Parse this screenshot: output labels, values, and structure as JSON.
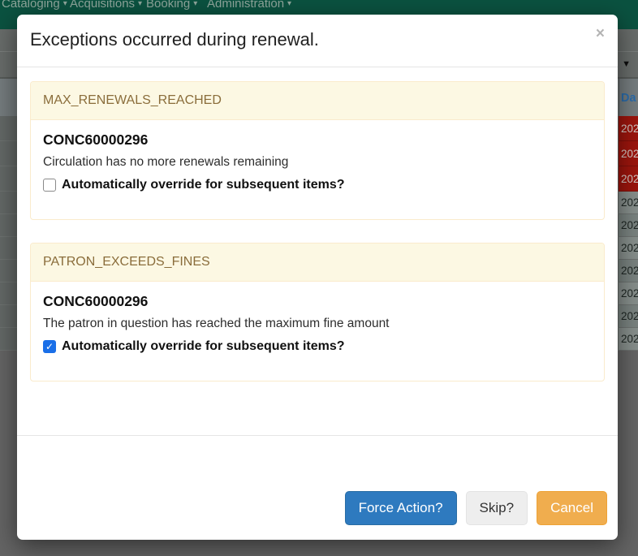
{
  "icons": {
    "caret_down": "▾",
    "grid_caret": "▼",
    "close": "×",
    "checkmark": "✓"
  },
  "colors": {
    "navbar_green": "#0b5240",
    "overdue_cell_red": "#9c150d",
    "panel_heading_bg": "#fcf8e3",
    "panel_heading_text": "#8a6d3b",
    "primary_button": "#2e7abf",
    "warning_button": "#f0ad4e",
    "checked_checkbox": "#1a6fe8"
  },
  "navbar": {
    "items": [
      {
        "label": "Cataloging"
      },
      {
        "label": "Acquisitions"
      },
      {
        "label": "Booking"
      },
      {
        "label": "Administration"
      }
    ]
  },
  "background_grid": {
    "column_header_fragment": "Da",
    "rows": [
      {
        "text": "202",
        "overdue": true
      },
      {
        "text": "202",
        "overdue": true
      },
      {
        "text": "202",
        "overdue": true
      },
      {
        "text": "202",
        "overdue": false
      },
      {
        "text": "202",
        "overdue": false
      },
      {
        "text": "202",
        "overdue": false
      },
      {
        "text": "202",
        "overdue": false
      },
      {
        "text": "202",
        "overdue": false
      },
      {
        "text": "202",
        "overdue": false
      },
      {
        "text": "202",
        "overdue": false
      }
    ]
  },
  "modal": {
    "title": "Exceptions occurred during renewal.",
    "exceptions": [
      {
        "code": "MAX_RENEWALS_REACHED",
        "barcode": "CONC60000296",
        "message": "Circulation has no more renewals remaining",
        "override_label": "Automatically override for subsequent items?",
        "override_checked": false
      },
      {
        "code": "PATRON_EXCEEDS_FINES",
        "barcode": "CONC60000296",
        "message": "The patron in question has reached the maximum fine amount",
        "override_label": "Automatically override for subsequent items?",
        "override_checked": true
      }
    ],
    "buttons": [
      {
        "label": "Force Action?"
      },
      {
        "label": "Skip?"
      },
      {
        "label": "Cancel"
      }
    ]
  }
}
